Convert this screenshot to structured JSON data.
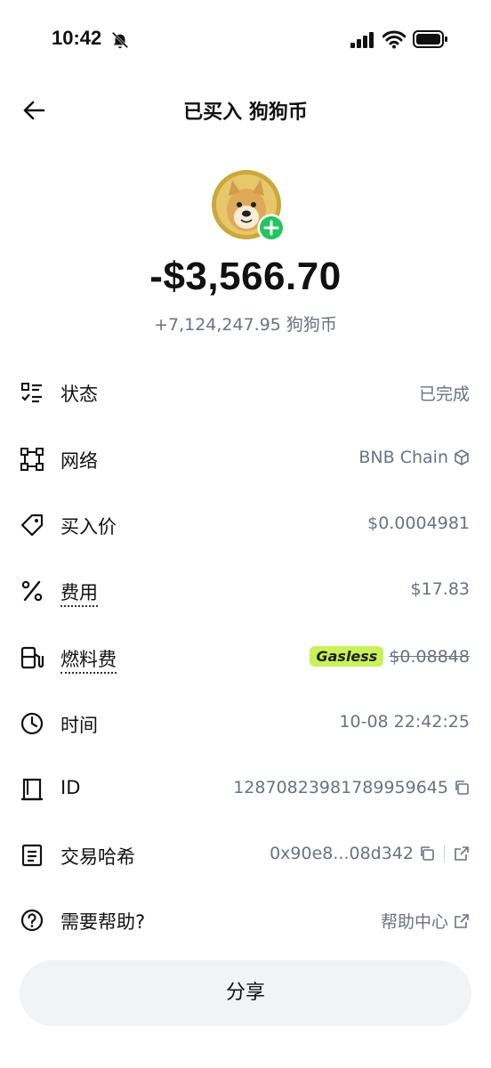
{
  "status_bar": {
    "time": "10:42",
    "icons": [
      "bell-mute-icon",
      "cellular-signal-icon",
      "wifi-icon",
      "battery-icon"
    ]
  },
  "header": {
    "back_icon": "arrow-left-icon",
    "title": "已买入 狗狗币"
  },
  "summary": {
    "coin_icon": "doge-coin-icon",
    "badge_icon": "plus-circle-icon",
    "badge_color": "#22c55e",
    "amount": "-$3,566.70",
    "quantity": "+7,124,247.95 狗狗币"
  },
  "rows": {
    "status": {
      "icon": "list-check-icon",
      "label": "状态",
      "value": "已完成"
    },
    "network": {
      "icon": "network-frame-icon",
      "label": "网络",
      "value": "BNB Chain",
      "value_icon": "bnb-cube-icon"
    },
    "price": {
      "icon": "price-tag-icon",
      "label": "买入价",
      "value": "$0.0004981"
    },
    "fee": {
      "icon": "percent-icon",
      "label": "费用",
      "value": "$17.83"
    },
    "gas": {
      "icon": "fuel-pump-icon",
      "label": "燃料费",
      "badge": "Gasless",
      "badge_color": "#c8f25a",
      "value": "$0.08848"
    },
    "time": {
      "icon": "clock-icon",
      "label": "时间",
      "value": "10-08 22:42:25"
    },
    "id": {
      "icon": "receipt-icon",
      "label": "ID",
      "value": "12870823981789959645",
      "value_icon": "copy-icon"
    },
    "hash": {
      "icon": "document-icon",
      "label": "交易哈希",
      "value": "0x90e8...08d342",
      "value_icons": [
        "copy-icon",
        "external-link-icon"
      ]
    },
    "help": {
      "icon": "question-circle-icon",
      "label": "需要帮助?",
      "value": "帮助中心",
      "value_icon": "external-link-icon"
    }
  },
  "footer": {
    "share_label": "分享"
  }
}
